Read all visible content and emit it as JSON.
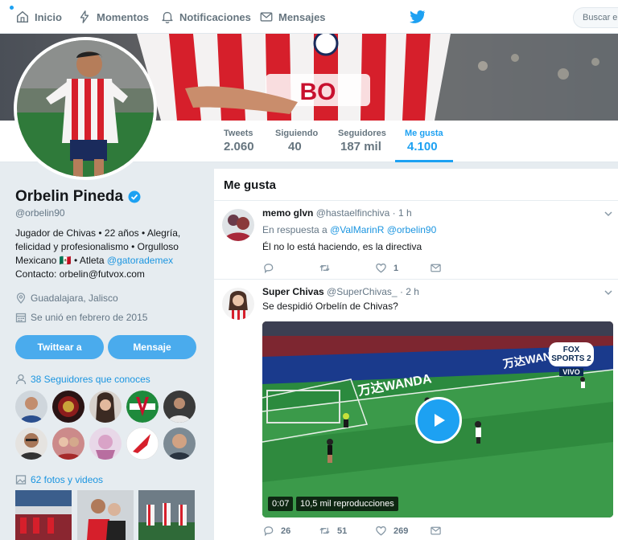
{
  "nav": {
    "home": "Inicio",
    "moments": "Momentos",
    "notifications": "Notificaciones",
    "messages": "Mensajes",
    "search_placeholder": "Buscar en"
  },
  "stats": [
    {
      "label": "Tweets",
      "value": "2.060"
    },
    {
      "label": "Siguiendo",
      "value": "40"
    },
    {
      "label": "Seguidores",
      "value": "187 mil"
    },
    {
      "label": "Me gusta",
      "value": "4.100"
    }
  ],
  "profile": {
    "name": "Orbelin Pineda",
    "handle": "@orbelin90",
    "bio_1": "Jugador de Chivas • 22 años • Alegría, felicidad y profesionalismo • Orgulloso Mexicano",
    "bio_flag": "🇲🇽",
    "bio_2": "• Atleta",
    "bio_link": "@gatorademex",
    "bio_contact": "Contacto: orbelin@futvox.com",
    "location": "Guadalajara, Jalisco",
    "joined": "Se unió en febrero de 2015",
    "tweet_button": "Twittear a",
    "message_button": "Mensaje",
    "followers_you_know": "38 Seguidores que conoces",
    "photos_videos": "62 fotos y videos"
  },
  "feed": {
    "title": "Me gusta",
    "tweets": [
      {
        "name": "memo glvn",
        "handle": "@hastaelfinchiva",
        "time": "· 1 h",
        "reply_prefix": "En respuesta a",
        "reply_to": "@ValMarinR @orbelin90",
        "text": "Él no lo está haciendo, es la directiva",
        "replies": "",
        "retweets": "",
        "likes": "1"
      },
      {
        "name": "Super Chivas",
        "handle": "@SuperChivas_",
        "time": "· 2 h",
        "text": "Se despidió Orbelín de Chivas?",
        "video_time": "0:07",
        "video_views": "10,5 mil reproducciones",
        "ad_text": "万达WANDA",
        "broadcaster": "FOX SPORTS 2",
        "live": "VIVO",
        "replies": "26",
        "retweets": "51",
        "likes": "269"
      }
    ]
  },
  "colors": {
    "accent": "#1da1f2",
    "link": "#1b95e0",
    "button": "#4aabed",
    "background": "#e6ecf0"
  }
}
